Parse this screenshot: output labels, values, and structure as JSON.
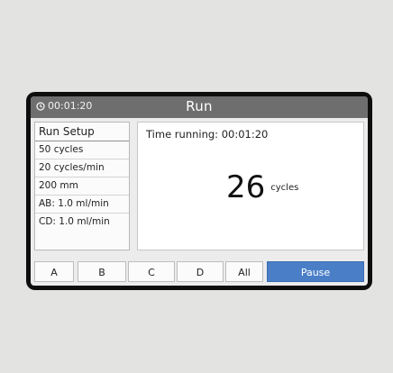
{
  "titlebar": {
    "elapsed": "00:01:20",
    "title": "Run"
  },
  "setup": {
    "title": "Run Setup",
    "rows": [
      "50 cycles",
      "20 cycles/min",
      "200 mm",
      "AB: 1.0 ml/min",
      "CD: 1.0 ml/min"
    ]
  },
  "main": {
    "time_label": "Time running: 00:01:20",
    "cycles_value": "26",
    "cycles_unit": "cycles"
  },
  "buttons": {
    "a": "A",
    "b": "B",
    "c": "C",
    "d": "D",
    "all": "All",
    "pause": "Pause"
  },
  "colors": {
    "titlebar": "#6e6e6e",
    "pause_button": "#4a7fc8",
    "bezel": "#0e0e0e"
  },
  "icons": {
    "clock": "clock-icon"
  }
}
